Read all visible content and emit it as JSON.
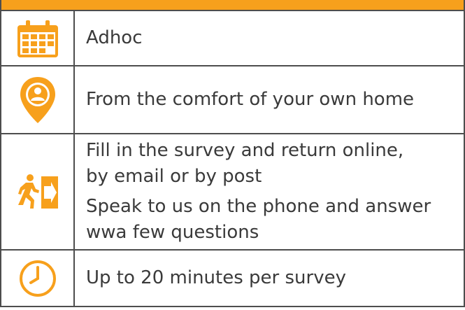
{
  "accent_color": "#f7a01c",
  "border_color": "#4d4d4d",
  "rows": [
    {
      "icon": "calendar-icon",
      "lines": [
        "Adhoc"
      ]
    },
    {
      "icon": "location-person-icon",
      "lines": [
        "From the comfort of your own home"
      ]
    },
    {
      "icon": "exit-running-person-icon",
      "lines": [
        "Fill in the survey and return online,",
        "by email or by post",
        "Speak to us on the phone and answer",
        "wwa few questions"
      ]
    },
    {
      "icon": "clock-icon",
      "lines": [
        "Up to 20 minutes per survey"
      ]
    }
  ]
}
